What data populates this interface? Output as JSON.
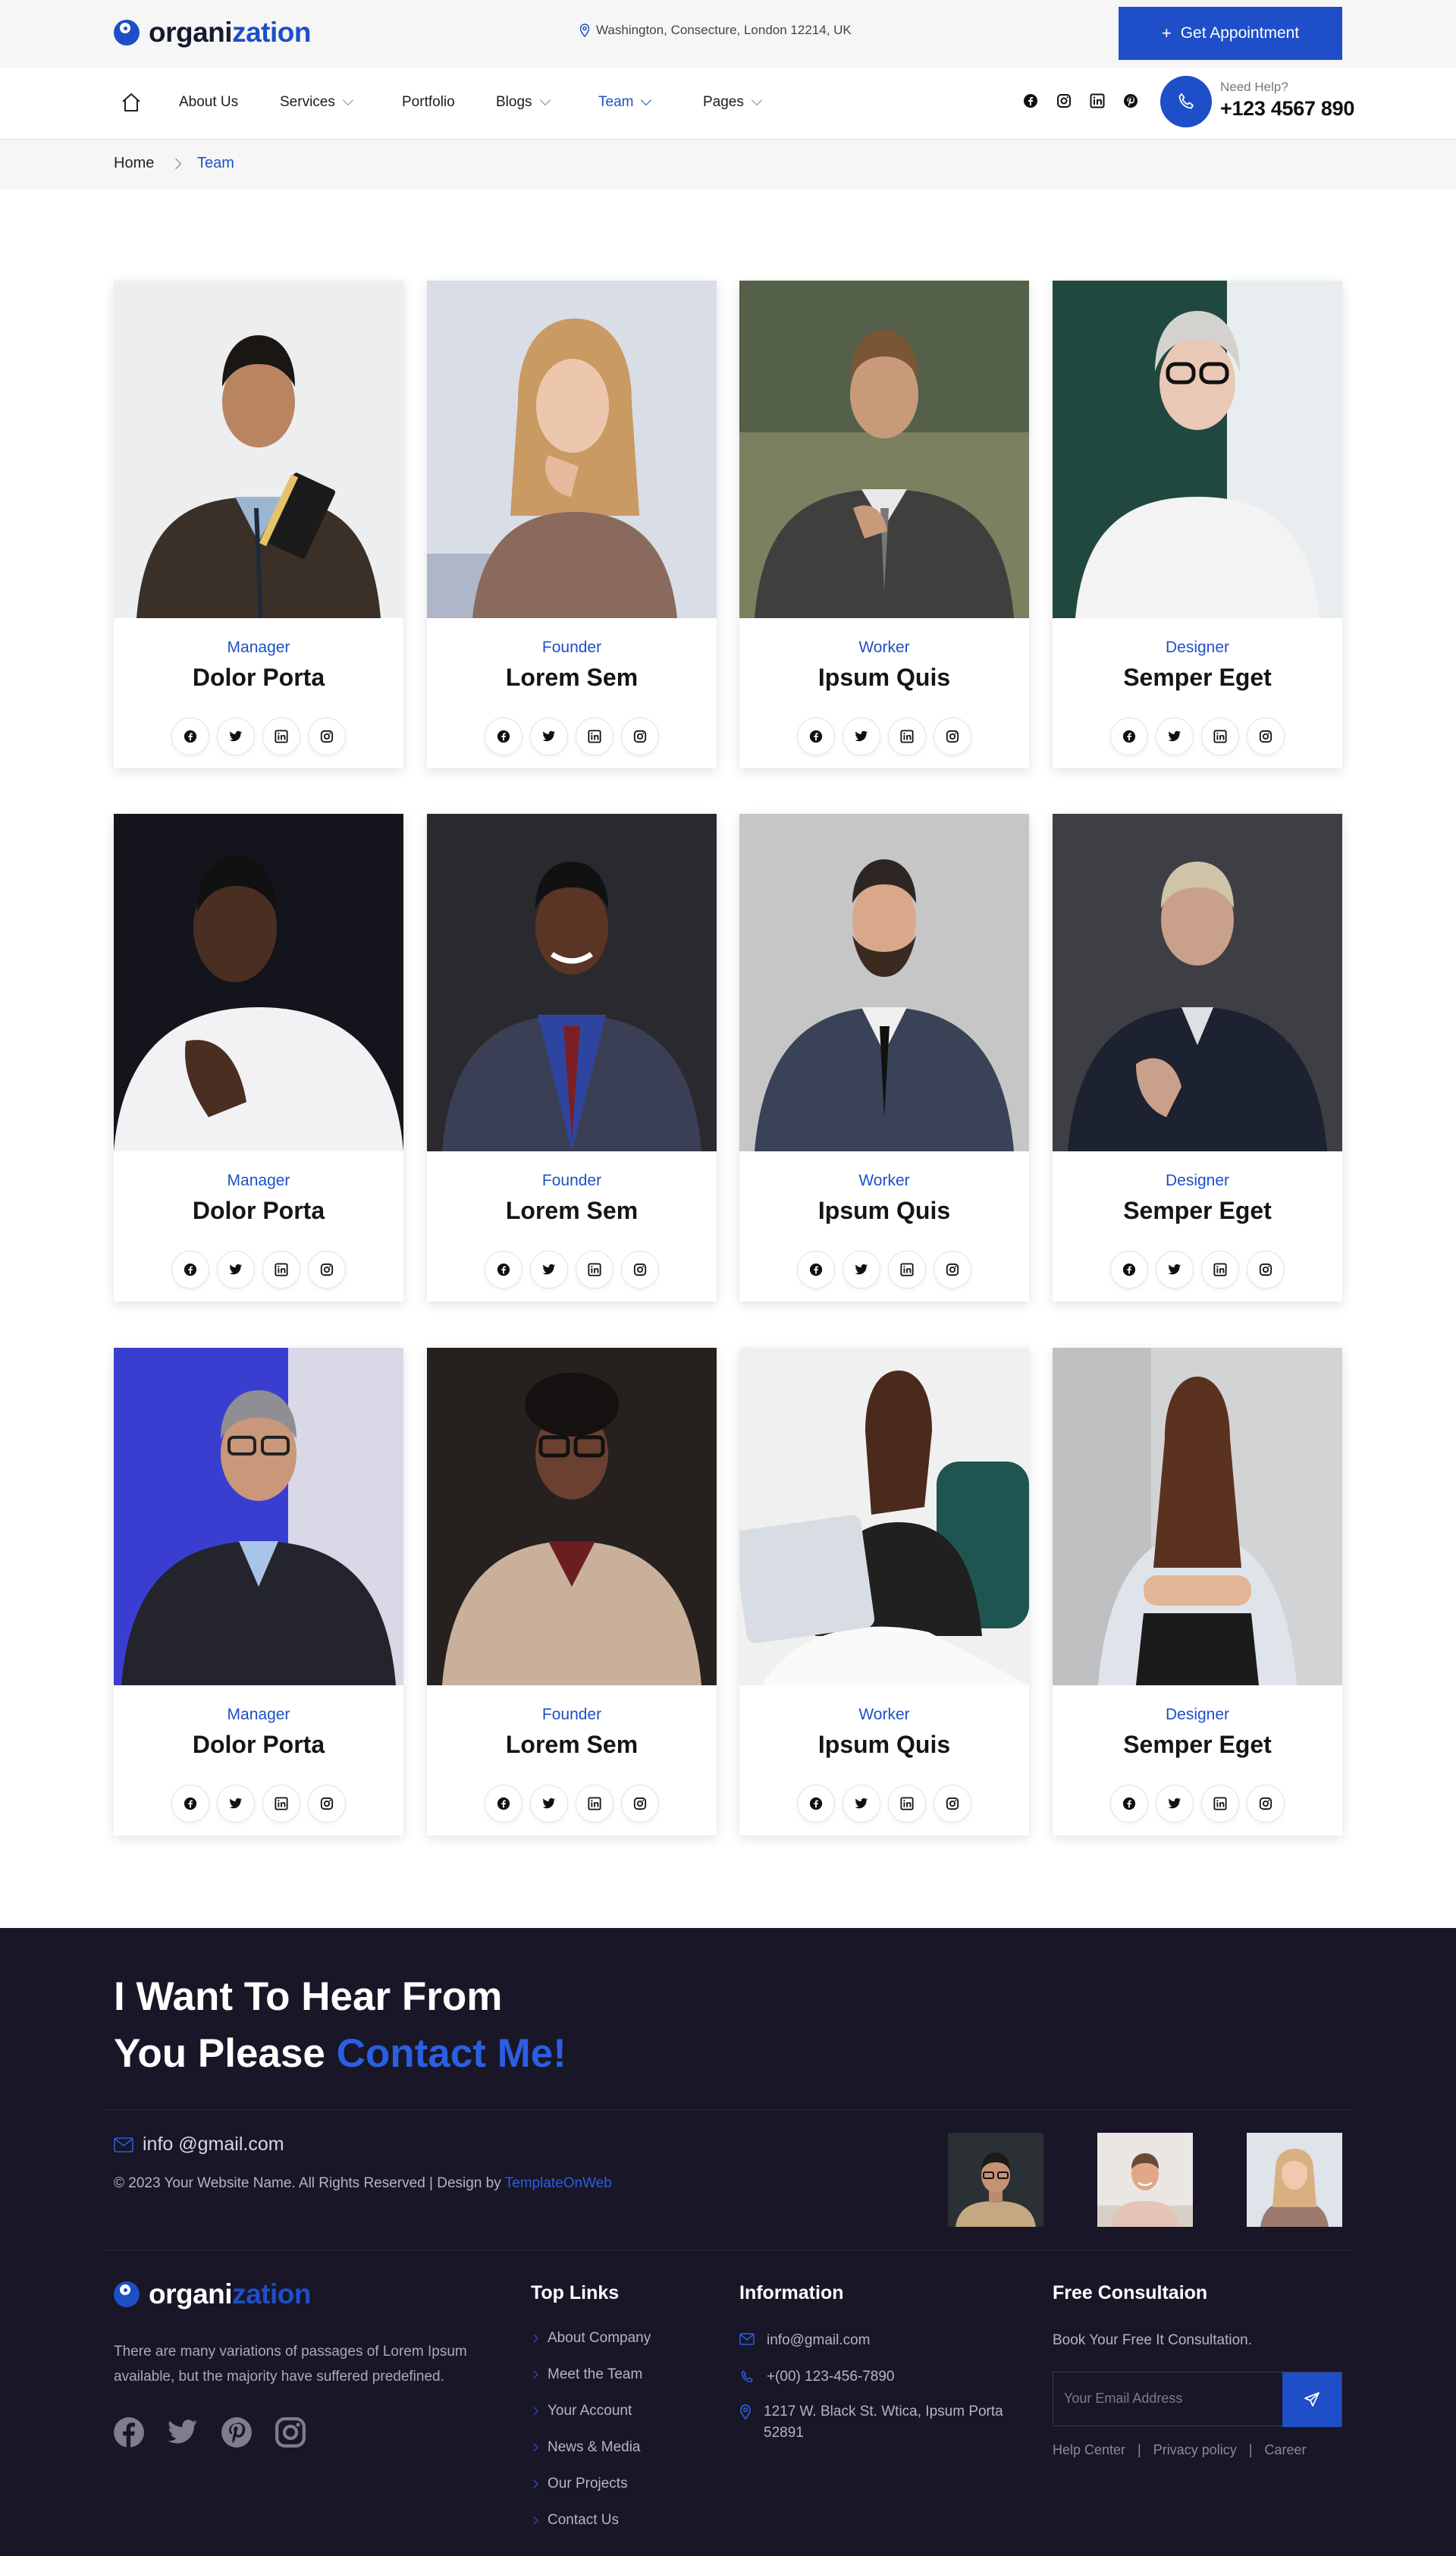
{
  "brand": {
    "logo_part1": "organi",
    "logo_part2": "zation"
  },
  "topbar": {
    "address": "Washington, Consecture, London 12214, UK",
    "appointment_button": "Get Appointment"
  },
  "nav": {
    "items": [
      "About Us",
      "Services",
      "Portfolio",
      "Blogs",
      "Team",
      "Pages"
    ],
    "active": "Team",
    "help_label": "Need Help?",
    "help_phone": "+123 4567 890"
  },
  "breadcrumb": {
    "home": "Home",
    "current": "Team"
  },
  "team": [
    {
      "role": "Manager",
      "name": "Dolor Porta"
    },
    {
      "role": "Founder",
      "name": "Lorem Sem"
    },
    {
      "role": "Worker",
      "name": "Ipsum Quis"
    },
    {
      "role": "Designer",
      "name": "Semper Eget"
    },
    {
      "role": "Manager",
      "name": "Dolor Porta"
    },
    {
      "role": "Founder",
      "name": "Lorem Sem"
    },
    {
      "role": "Worker",
      "name": "Ipsum Quis"
    },
    {
      "role": "Designer",
      "name": "Semper Eget"
    },
    {
      "role": "Manager",
      "name": "Dolor Porta"
    },
    {
      "role": "Founder",
      "name": "Lorem Sem"
    },
    {
      "role": "Worker",
      "name": "Ipsum Quis"
    },
    {
      "role": "Designer",
      "name": "Semper Eget"
    }
  ],
  "card_socials": [
    "facebook-icon",
    "twitter-icon",
    "linkedin-icon",
    "instagram-icon"
  ],
  "footer": {
    "heading_line1": "I Want To Hear From",
    "heading_line2_plain": "You Please",
    "heading_line2_highlight": "Contact Me!",
    "email": "info @gmail.com",
    "copyright_plain": "© 2023 Your Website Name. All Rights Reserved | Design by",
    "copyright_link": "TemplateOnWeb",
    "description": "There are many variations of passages of Lorem Ipsum available, but the majority have suffered predefined.",
    "top_links_title": "Top Links",
    "top_links": [
      "About Company",
      "Meet the Team",
      "Your Account",
      "News & Media",
      "Our Projects",
      "Contact Us"
    ],
    "info_title": "Information",
    "info_email": "info@gmail.com",
    "info_phone": "+(00) 123-456-7890",
    "info_address": "1217 W. Black St. Wtica, Ipsum Porta 52891",
    "consult_title": "Free Consultaion",
    "consult_text": "Book Your Free It Consultation.",
    "email_placeholder": "Your Email Address",
    "bottom_links": [
      "Help Center",
      "Privacy policy",
      "Career"
    ]
  },
  "colors": {
    "accent": "#1e4fc8",
    "footer_bg": "#181627",
    "topbar_bg": "#f6f6f7"
  }
}
